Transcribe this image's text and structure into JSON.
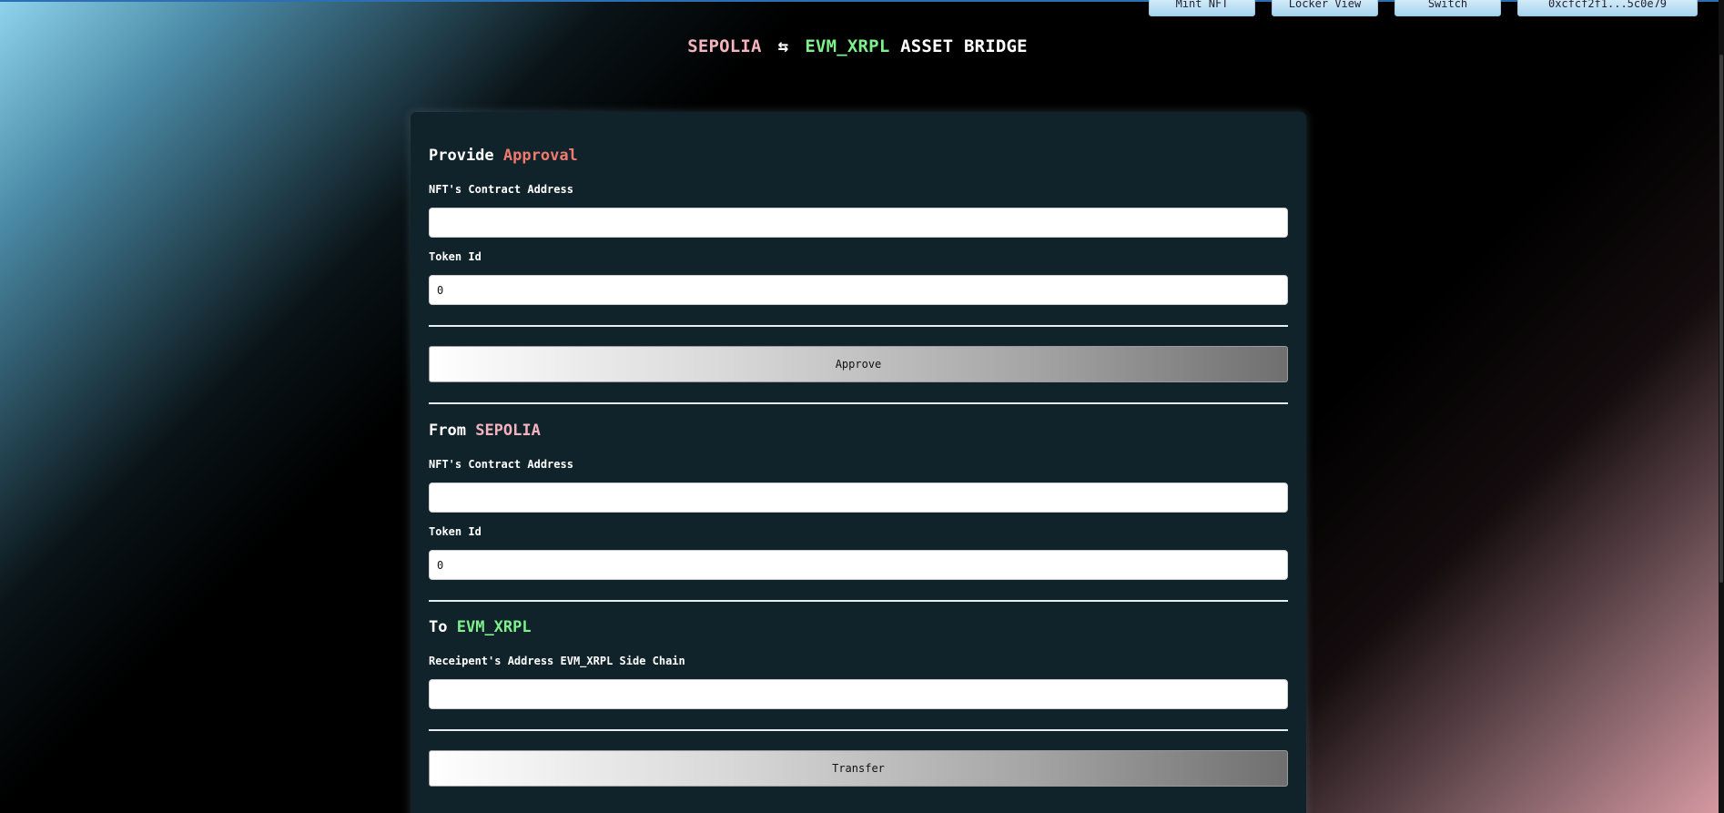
{
  "nav": {
    "buttons": [
      "Mint NFT",
      "Locker View",
      "Switch",
      "0xcfcf2f1...5c0e79"
    ]
  },
  "header": {
    "source_chain": "SEPOLIA",
    "swap_symbol": "⇆",
    "dest_chain": "EVM_XRPL",
    "title_suffix": "ASSET BRIDGE"
  },
  "approval": {
    "title_prefix": "Provide",
    "title_accent": "Approval",
    "contract_label": "NFT's Contract Address",
    "contract_value": "",
    "token_label": "Token Id",
    "token_value": "0",
    "approve_label": "Approve"
  },
  "from": {
    "title_prefix": "From",
    "title_accent": "SEPOLIA",
    "contract_label": "NFT's Contract Address",
    "contract_value": "",
    "token_label": "Token Id",
    "token_value": "0"
  },
  "to": {
    "title_prefix": "To",
    "title_accent": "EVM_XRPL",
    "recipient_label": "Receipent's Address EVM_XRPL Side Chain",
    "recipient_value": "",
    "transfer_label": "Transfer"
  },
  "colors": {
    "card_bg": "#10232b",
    "accent_red": "#f07a6e",
    "accent_pink": "#f4b3bd",
    "accent_green": "#7ef08c"
  }
}
